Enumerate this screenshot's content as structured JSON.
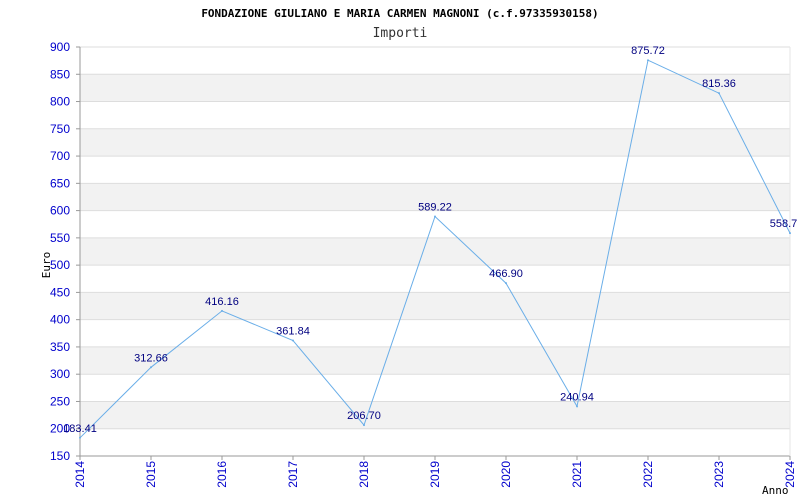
{
  "chart_data": {
    "type": "line",
    "title": "FONDAZIONE GIULIANO E MARIA CARMEN MAGNONI (c.f.97335930158)",
    "subtitle": "Importi",
    "xlabel": "Anno",
    "ylabel": "Euro",
    "x": [
      "2014",
      "2015",
      "2016",
      "2017",
      "2018",
      "2019",
      "2020",
      "2021",
      "2022",
      "2023",
      "2024"
    ],
    "y_ticks": [
      150,
      200,
      250,
      300,
      350,
      400,
      450,
      500,
      550,
      600,
      650,
      700,
      750,
      800,
      850,
      900
    ],
    "ylim": [
      150,
      900
    ],
    "series": [
      {
        "values": [
          183.41,
          312.66,
          416.16,
          361.84,
          206.7,
          589.22,
          466.9,
          240.94,
          875.72,
          815.36,
          558.7
        ],
        "labels": [
          "183.41",
          "312.66",
          "416.16",
          "361.84",
          "206.70",
          "589.22",
          "466.90",
          "240.94",
          "875.72",
          "815.36",
          "558.7"
        ]
      }
    ],
    "grid": true,
    "banded_background": true,
    "legend": "none",
    "colors": {
      "line": "#6aaee8",
      "band": "#f2f2f2",
      "grid": "#dddddd",
      "tick_text": "#0000cc",
      "data_label": "#000080"
    }
  }
}
